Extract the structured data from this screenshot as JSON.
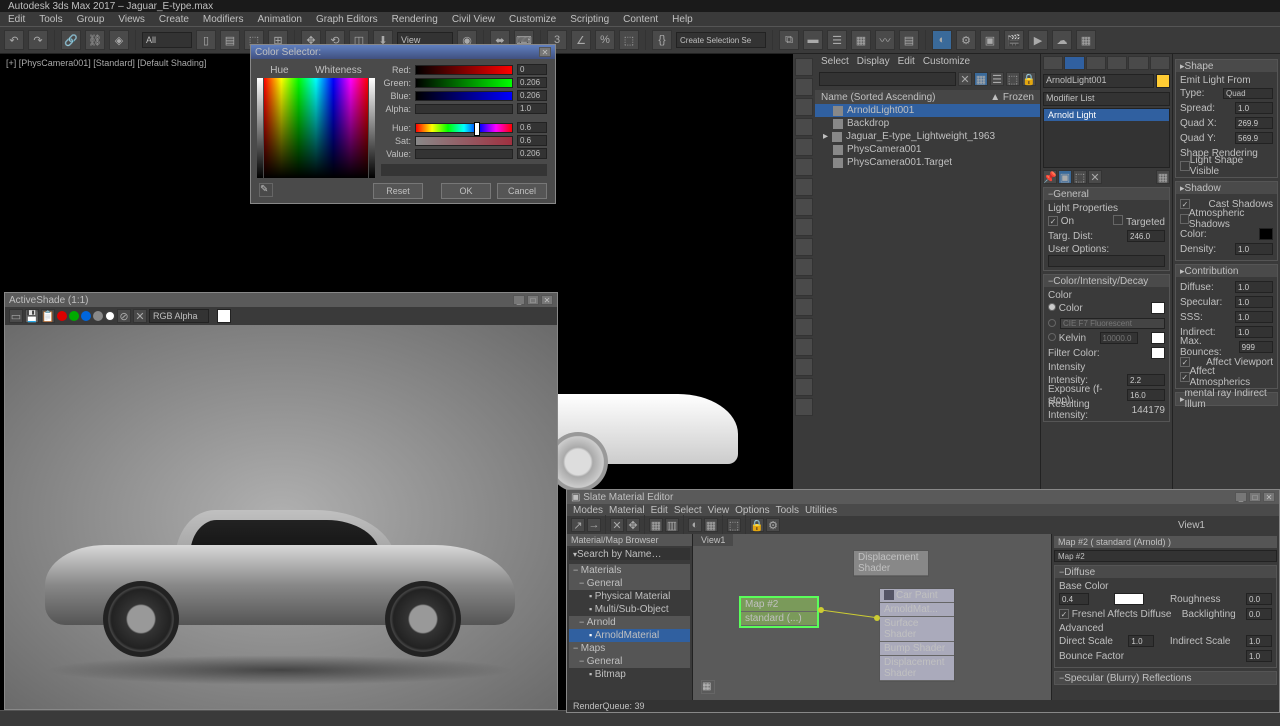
{
  "app_title": "Autodesk 3ds Max 2017 – Jaguar_E-type.max",
  "menu": [
    "Edit",
    "Tools",
    "Group",
    "Views",
    "Create",
    "Modifiers",
    "Animation",
    "Graph Editors",
    "Rendering",
    "Civil View",
    "Customize",
    "Scripting",
    "Content",
    "Help"
  ],
  "toolbar": {
    "set_dropdown": "All",
    "view_dropdown": "View",
    "sel_set": "Create Selection Se"
  },
  "viewport_label": "[+] [PhysCamera001] [Standard] [Default Shading]",
  "color_selector": {
    "title": "Color Selector:",
    "hue_label": "Hue",
    "white_label": "Whiteness",
    "channels": [
      {
        "label": "Red:",
        "val": "0"
      },
      {
        "label": "Green:",
        "val": "0.206"
      },
      {
        "label": "Blue:",
        "val": "0.206"
      },
      {
        "label": "Alpha:",
        "val": "1.0"
      }
    ],
    "hsv": [
      {
        "label": "Hue:",
        "val": "0.6"
      },
      {
        "label": "Sat:",
        "val": "0.6"
      },
      {
        "label": "Value:",
        "val": "0.206"
      }
    ],
    "reset": "Reset",
    "ok": "OK",
    "cancel": "Cancel"
  },
  "activeshade": {
    "title": "ActiveShade (1:1)",
    "channel": "RGB Alpha"
  },
  "scene": {
    "menu": [
      "Select",
      "Display",
      "Edit",
      "Customize"
    ],
    "header": "Name (Sorted Ascending)",
    "frozen": "Frozen",
    "items": [
      "ArnoldLight001",
      "Backdrop",
      "Jaguar_E-type_Lightweight_1963",
      "PhysCamera001",
      "PhysCamera001.Target"
    ]
  },
  "command": {
    "object_name": "ArnoldLight001",
    "modifier_list_label": "Modifier List",
    "stack_item": "Arnold Light",
    "rollouts": {
      "general": {
        "title": "General",
        "light_props": "Light Properties",
        "on": "On",
        "targeted": "Targeted",
        "targ_dist": "Targ. Dist:",
        "targ_dist_val": "246.0",
        "user_options": "User Options:"
      },
      "color": {
        "title": "Color/Intensity/Decay",
        "color_label": "Color",
        "color_item": "Color",
        "preset": "CIE F7 Fluorescent",
        "kelvin": "Kelvin",
        "kelvin_val": "10000.0",
        "filter": "Filter Color:",
        "intensity_label": "Intensity",
        "intensity": "Intensity:",
        "intensity_val": "2.2",
        "exposure": "Exposure (f-stop):",
        "exposure_val": "16.0",
        "resulting": "Resulting Intensity:",
        "resulting_val": "144179"
      }
    }
  },
  "right": {
    "shape": {
      "title": "Shape",
      "emit": "Emit Light From",
      "type": "Type:",
      "type_val": "Quad",
      "spread": "Spread:",
      "spread_val": "1.0",
      "quadx": "Quad X:",
      "quadx_val": "269.9",
      "quady": "Quad Y:",
      "quady_val": "569.9",
      "shape_rendering": "Shape Rendering",
      "light_shape_visible": "Light Shape Visible"
    },
    "shadow": {
      "title": "Shadow",
      "cast": "Cast Shadows",
      "atmos": "Atmospheric Shadows",
      "color": "Color:",
      "density": "Density:",
      "density_val": "1.0"
    },
    "contribution": {
      "title": "Contribution",
      "diffuse": "Diffuse:",
      "dv": "1.0",
      "specular": "Specular:",
      "sv": "1.0",
      "sss": "SSS:",
      "ssv": "1.0",
      "indirect": "Indirect:",
      "iv": "1.0",
      "max": "Max. Bounces:",
      "mv": "999",
      "viewport": "Affect Viewport",
      "atmos": "Affect Atmospherics"
    },
    "mental": {
      "title": "mental ray Indirect Illum"
    }
  },
  "slate": {
    "title": "Slate Material Editor",
    "menu": [
      "Modes",
      "Material",
      "Edit",
      "Select",
      "View",
      "Options",
      "Tools",
      "Utilities"
    ],
    "browser_title": "Material/Map Browser",
    "search": "Search by Name…",
    "tree": {
      "materials": "Materials",
      "general": "General",
      "physical": "Physical Material",
      "multi": "Multi/Sub-Object",
      "arnold": "Arnold",
      "arnold_mat": "ArnoldMaterial",
      "maps": "Maps",
      "general2": "General",
      "bitmap": "Bitmap"
    },
    "view_tab": "View1",
    "nodes": {
      "disp": "Displacement Shader",
      "map": {
        "l1": "Map #2",
        "l2": "standard (...)"
      },
      "car": {
        "l1": "Car Paint",
        "l2": "ArnoldMat...",
        "l3": "Surface Shader",
        "l4": "Bump Shader",
        "l5": "Displacement Shader"
      }
    },
    "params": {
      "title": "Map #2  ( standard (Arnold) )",
      "name": "Map #2",
      "diffuse_title": "Diffuse",
      "base_color": "Base Color",
      "base_val": "0.4",
      "roughness": "Roughness",
      "roughness_val": "0.0",
      "fresnel": "Fresnel Affects Diffuse",
      "backlighting": "Backlighting",
      "backlighting_val": "0.0",
      "advanced": "Advanced",
      "direct": "Direct Scale",
      "direct_val": "1.0",
      "indirect": "Indirect Scale",
      "indirect_val": "1.0",
      "bounce": "Bounce Factor",
      "bounce_val": "1.0",
      "specular_title": "Specular (Blurry) Reflections"
    },
    "status": "RenderQueue: 39",
    "right_label": "View1"
  }
}
